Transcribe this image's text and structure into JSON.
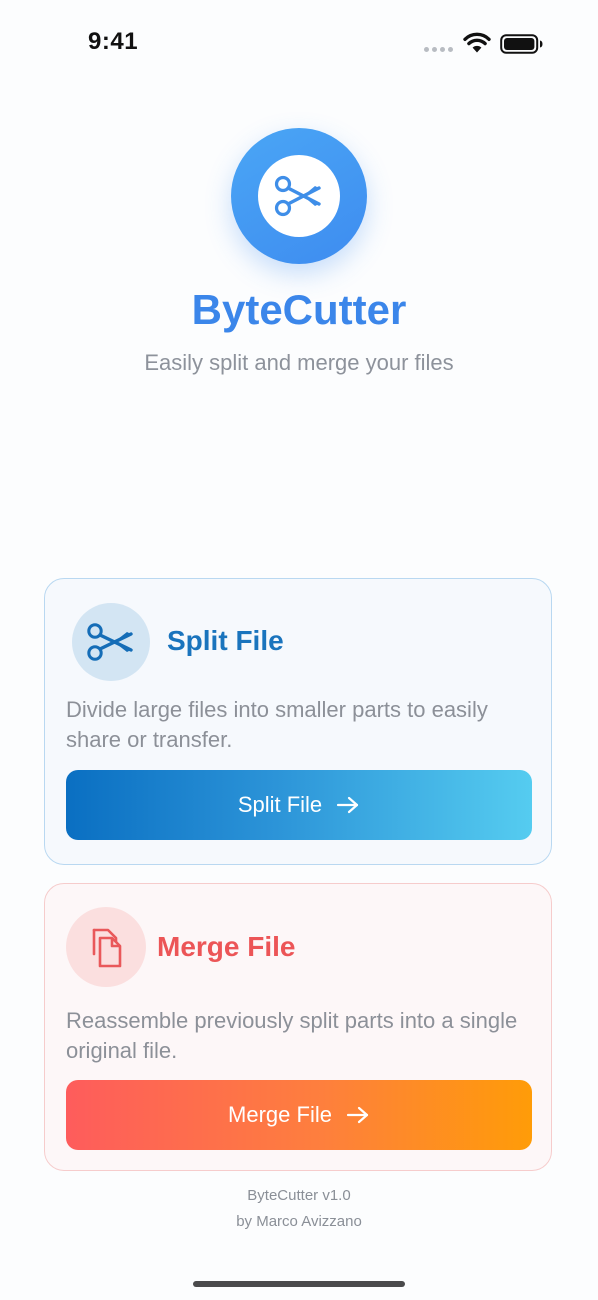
{
  "status_bar": {
    "time": "9:41",
    "icons": [
      "cellular-dots-icon",
      "wifi-icon",
      "battery-icon"
    ]
  },
  "hero": {
    "logo_icon": "scissors-icon",
    "title": "ByteCutter",
    "subtitle": "Easily split and merge your files"
  },
  "split_card": {
    "icon": "scissors-icon",
    "title": "Split File",
    "description": "Divide large files into smaller parts to easily share or transfer.",
    "button_label": "Split File",
    "button_icon": "arrow-right-icon"
  },
  "merge_card": {
    "icon": "documents-icon",
    "title": "Merge File",
    "description": "Reassemble previously split parts into a single original file.",
    "button_label": "Merge File",
    "button_icon": "arrow-right-icon"
  },
  "footer": {
    "version": "ByteCutter v1.0",
    "author": "by Marco Avizzano"
  },
  "colors": {
    "brand_blue": "#3b86ea",
    "split_accent": "#1a74bd",
    "merge_accent": "#ec5557",
    "split_gradient": [
      "#0a6fc2",
      "#55ccf0"
    ],
    "merge_gradient": [
      "#fe5c5c",
      "#ff9c08"
    ]
  }
}
